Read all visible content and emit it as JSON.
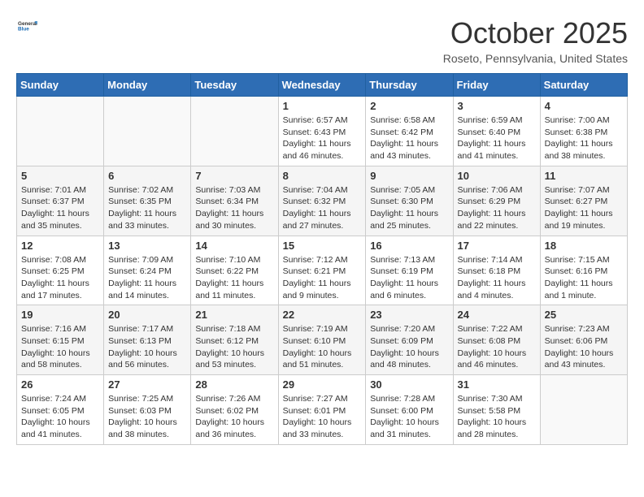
{
  "logo": {
    "text_general": "General",
    "text_blue": "Blue"
  },
  "title": {
    "month": "October 2025",
    "location": "Roseto, Pennsylvania, United States"
  },
  "weekdays": [
    "Sunday",
    "Monday",
    "Tuesday",
    "Wednesday",
    "Thursday",
    "Friday",
    "Saturday"
  ],
  "weeks": [
    [
      {
        "day": "",
        "info": ""
      },
      {
        "day": "",
        "info": ""
      },
      {
        "day": "",
        "info": ""
      },
      {
        "day": "1",
        "info": "Sunrise: 6:57 AM\nSunset: 6:43 PM\nDaylight: 11 hours\nand 46 minutes."
      },
      {
        "day": "2",
        "info": "Sunrise: 6:58 AM\nSunset: 6:42 PM\nDaylight: 11 hours\nand 43 minutes."
      },
      {
        "day": "3",
        "info": "Sunrise: 6:59 AM\nSunset: 6:40 PM\nDaylight: 11 hours\nand 41 minutes."
      },
      {
        "day": "4",
        "info": "Sunrise: 7:00 AM\nSunset: 6:38 PM\nDaylight: 11 hours\nand 38 minutes."
      }
    ],
    [
      {
        "day": "5",
        "info": "Sunrise: 7:01 AM\nSunset: 6:37 PM\nDaylight: 11 hours\nand 35 minutes."
      },
      {
        "day": "6",
        "info": "Sunrise: 7:02 AM\nSunset: 6:35 PM\nDaylight: 11 hours\nand 33 minutes."
      },
      {
        "day": "7",
        "info": "Sunrise: 7:03 AM\nSunset: 6:34 PM\nDaylight: 11 hours\nand 30 minutes."
      },
      {
        "day": "8",
        "info": "Sunrise: 7:04 AM\nSunset: 6:32 PM\nDaylight: 11 hours\nand 27 minutes."
      },
      {
        "day": "9",
        "info": "Sunrise: 7:05 AM\nSunset: 6:30 PM\nDaylight: 11 hours\nand 25 minutes."
      },
      {
        "day": "10",
        "info": "Sunrise: 7:06 AM\nSunset: 6:29 PM\nDaylight: 11 hours\nand 22 minutes."
      },
      {
        "day": "11",
        "info": "Sunrise: 7:07 AM\nSunset: 6:27 PM\nDaylight: 11 hours\nand 19 minutes."
      }
    ],
    [
      {
        "day": "12",
        "info": "Sunrise: 7:08 AM\nSunset: 6:25 PM\nDaylight: 11 hours\nand 17 minutes."
      },
      {
        "day": "13",
        "info": "Sunrise: 7:09 AM\nSunset: 6:24 PM\nDaylight: 11 hours\nand 14 minutes."
      },
      {
        "day": "14",
        "info": "Sunrise: 7:10 AM\nSunset: 6:22 PM\nDaylight: 11 hours\nand 11 minutes."
      },
      {
        "day": "15",
        "info": "Sunrise: 7:12 AM\nSunset: 6:21 PM\nDaylight: 11 hours\nand 9 minutes."
      },
      {
        "day": "16",
        "info": "Sunrise: 7:13 AM\nSunset: 6:19 PM\nDaylight: 11 hours\nand 6 minutes."
      },
      {
        "day": "17",
        "info": "Sunrise: 7:14 AM\nSunset: 6:18 PM\nDaylight: 11 hours\nand 4 minutes."
      },
      {
        "day": "18",
        "info": "Sunrise: 7:15 AM\nSunset: 6:16 PM\nDaylight: 11 hours\nand 1 minute."
      }
    ],
    [
      {
        "day": "19",
        "info": "Sunrise: 7:16 AM\nSunset: 6:15 PM\nDaylight: 10 hours\nand 58 minutes."
      },
      {
        "day": "20",
        "info": "Sunrise: 7:17 AM\nSunset: 6:13 PM\nDaylight: 10 hours\nand 56 minutes."
      },
      {
        "day": "21",
        "info": "Sunrise: 7:18 AM\nSunset: 6:12 PM\nDaylight: 10 hours\nand 53 minutes."
      },
      {
        "day": "22",
        "info": "Sunrise: 7:19 AM\nSunset: 6:10 PM\nDaylight: 10 hours\nand 51 minutes."
      },
      {
        "day": "23",
        "info": "Sunrise: 7:20 AM\nSunset: 6:09 PM\nDaylight: 10 hours\nand 48 minutes."
      },
      {
        "day": "24",
        "info": "Sunrise: 7:22 AM\nSunset: 6:08 PM\nDaylight: 10 hours\nand 46 minutes."
      },
      {
        "day": "25",
        "info": "Sunrise: 7:23 AM\nSunset: 6:06 PM\nDaylight: 10 hours\nand 43 minutes."
      }
    ],
    [
      {
        "day": "26",
        "info": "Sunrise: 7:24 AM\nSunset: 6:05 PM\nDaylight: 10 hours\nand 41 minutes."
      },
      {
        "day": "27",
        "info": "Sunrise: 7:25 AM\nSunset: 6:03 PM\nDaylight: 10 hours\nand 38 minutes."
      },
      {
        "day": "28",
        "info": "Sunrise: 7:26 AM\nSunset: 6:02 PM\nDaylight: 10 hours\nand 36 minutes."
      },
      {
        "day": "29",
        "info": "Sunrise: 7:27 AM\nSunset: 6:01 PM\nDaylight: 10 hours\nand 33 minutes."
      },
      {
        "day": "30",
        "info": "Sunrise: 7:28 AM\nSunset: 6:00 PM\nDaylight: 10 hours\nand 31 minutes."
      },
      {
        "day": "31",
        "info": "Sunrise: 7:30 AM\nSunset: 5:58 PM\nDaylight: 10 hours\nand 28 minutes."
      },
      {
        "day": "",
        "info": ""
      }
    ]
  ]
}
